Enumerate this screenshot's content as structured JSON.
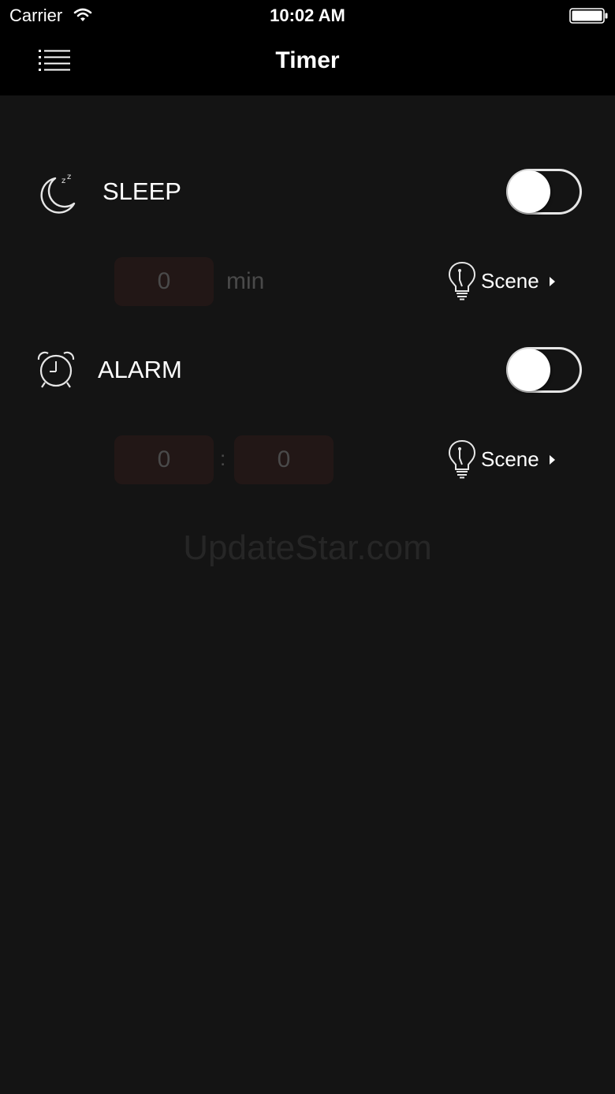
{
  "status_bar": {
    "carrier": "Carrier",
    "time": "10:02 AM",
    "wifi_icon": "wifi-icon",
    "battery_icon": "battery-icon"
  },
  "nav": {
    "title": "Timer",
    "menu_icon": "list-menu-icon"
  },
  "sleep": {
    "label": "SLEEP",
    "icon": "moon-zzz-icon",
    "enabled": false,
    "minutes_value": "0",
    "unit": "min",
    "scene_label": "Scene"
  },
  "alarm": {
    "label": "ALARM",
    "icon": "alarm-clock-icon",
    "enabled": false,
    "hour_value": "0",
    "separator": ":",
    "minute_value": "0",
    "scene_label": "Scene"
  },
  "watermark": "UpdateStar.com",
  "colors": {
    "background": "#141414",
    "bar": "#000000",
    "field_bg": "#221716",
    "dim_text": "#4a4a4a"
  }
}
